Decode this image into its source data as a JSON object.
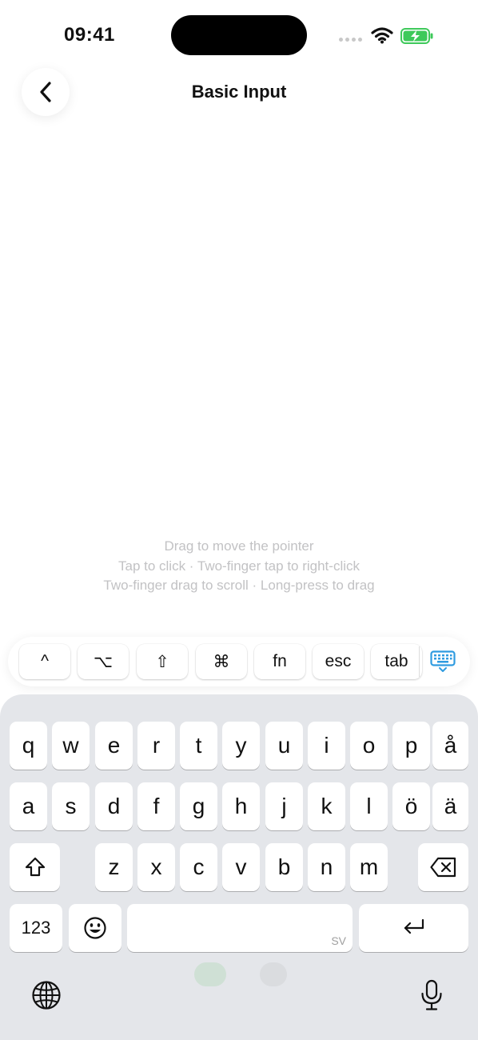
{
  "status_bar": {
    "time": "09:41"
  },
  "nav": {
    "title": "Basic Input"
  },
  "hints": [
    "Drag to move the pointer",
    "Tap to click · Two-finger tap to right-click",
    "Two-finger drag to scroll · Long-press to drag"
  ],
  "modifiers": [
    "^",
    "⌥",
    "⇧",
    "⌘",
    "fn",
    "esc",
    "tab"
  ],
  "keyboard": {
    "row1": [
      "q",
      "w",
      "e",
      "r",
      "t",
      "y",
      "u",
      "i",
      "o",
      "p",
      "å"
    ],
    "row2": [
      "a",
      "s",
      "d",
      "f",
      "g",
      "h",
      "j",
      "k",
      "l",
      "ö",
      "ä"
    ],
    "row3": [
      "z",
      "x",
      "c",
      "v",
      "b",
      "n",
      "m"
    ],
    "numbers_label": "123",
    "space_lang": "SV"
  },
  "colors": {
    "accent": "#2f9be0",
    "battery": "#3ec95a",
    "hint_text": "#c2c2c4",
    "keyboard_bg": "#e4e6ea"
  }
}
